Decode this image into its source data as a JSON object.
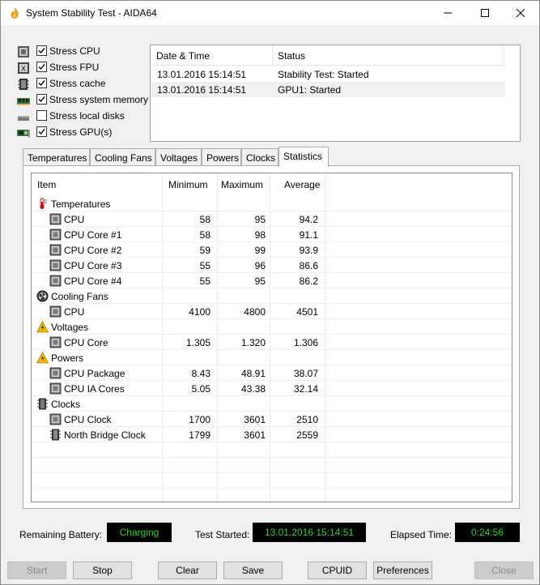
{
  "window": {
    "title": "System Stability Test - AIDA64"
  },
  "stress": [
    {
      "label": "Stress CPU",
      "checked": true,
      "icon": "cpu-chip-icon"
    },
    {
      "label": "Stress FPU",
      "checked": true,
      "icon": "fpu-chip-icon"
    },
    {
      "label": "Stress cache",
      "checked": true,
      "icon": "cache-chip-icon"
    },
    {
      "label": "Stress system memory",
      "checked": true,
      "icon": "memory-module-icon"
    },
    {
      "label": "Stress local disks",
      "checked": false,
      "icon": "hard-disk-icon"
    },
    {
      "label": "Stress GPU(s)",
      "checked": true,
      "icon": "gpu-card-icon"
    }
  ],
  "log": {
    "headers": [
      "Date & Time",
      "Status"
    ],
    "rows": [
      {
        "time": "13.01.2016 15:14:51",
        "status": "Stability Test: Started"
      },
      {
        "time": "13.01.2016 15:14:51",
        "status": "GPU1: Started"
      }
    ]
  },
  "tabs": [
    "Temperatures",
    "Cooling Fans",
    "Voltages",
    "Powers",
    "Clocks",
    "Statistics"
  ],
  "active_tab": "Statistics",
  "stats": {
    "headers": [
      "Item",
      "Minimum",
      "Maximum",
      "Average"
    ],
    "rows": [
      {
        "type": "group",
        "name": "Temperatures",
        "icon": "thermometer-icon"
      },
      {
        "type": "item",
        "name": "CPU",
        "min": "58",
        "max": "95",
        "avg": "94.2"
      },
      {
        "type": "item",
        "name": "CPU Core #1",
        "min": "58",
        "max": "98",
        "avg": "91.1"
      },
      {
        "type": "item",
        "name": "CPU Core #2",
        "min": "59",
        "max": "99",
        "avg": "93.9"
      },
      {
        "type": "item",
        "name": "CPU Core #3",
        "min": "55",
        "max": "96",
        "avg": "86.6"
      },
      {
        "type": "item",
        "name": "CPU Core #4",
        "min": "55",
        "max": "95",
        "avg": "86.2"
      },
      {
        "type": "group",
        "name": "Cooling Fans",
        "icon": "fan-icon"
      },
      {
        "type": "item",
        "name": "CPU",
        "min": "4100",
        "max": "4800",
        "avg": "4501"
      },
      {
        "type": "group",
        "name": "Voltages",
        "icon": "warning-bolt-icon"
      },
      {
        "type": "item",
        "name": "CPU Core",
        "min": "1.305",
        "max": "1.320",
        "avg": "1.306"
      },
      {
        "type": "group",
        "name": "Powers",
        "icon": "warning-bolt-icon"
      },
      {
        "type": "item",
        "name": "CPU Package",
        "min": "8.43",
        "max": "48.91",
        "avg": "38.07"
      },
      {
        "type": "item",
        "name": "CPU IA Cores",
        "min": "5.05",
        "max": "43.38",
        "avg": "32.14"
      },
      {
        "type": "group",
        "name": "Clocks",
        "icon": "clock-chip-icon"
      },
      {
        "type": "item",
        "name": "CPU Clock",
        "min": "1700",
        "max": "3601",
        "avg": "2510"
      },
      {
        "type": "item",
        "name": "North Bridge Clock",
        "min": "1799",
        "max": "3601",
        "avg": "2559",
        "icon": "bridge-chip-icon"
      }
    ]
  },
  "status": {
    "battery_label": "Remaining Battery:",
    "battery_value": "Charging",
    "started_label": "Test Started:",
    "started_value": "13.01.2016 15:14:51",
    "elapsed_label": "Elapsed Time:",
    "elapsed_value": "0:24:56"
  },
  "buttons": {
    "start": "Start",
    "stop": "Stop",
    "clear": "Clear",
    "save": "Save",
    "cpuid": "CPUID",
    "preferences": "Preferences",
    "close": "Close"
  },
  "colors": {
    "lcd_text": "#2bd62b",
    "lcd_bg": "#000000",
    "warning": "#f5b800"
  }
}
